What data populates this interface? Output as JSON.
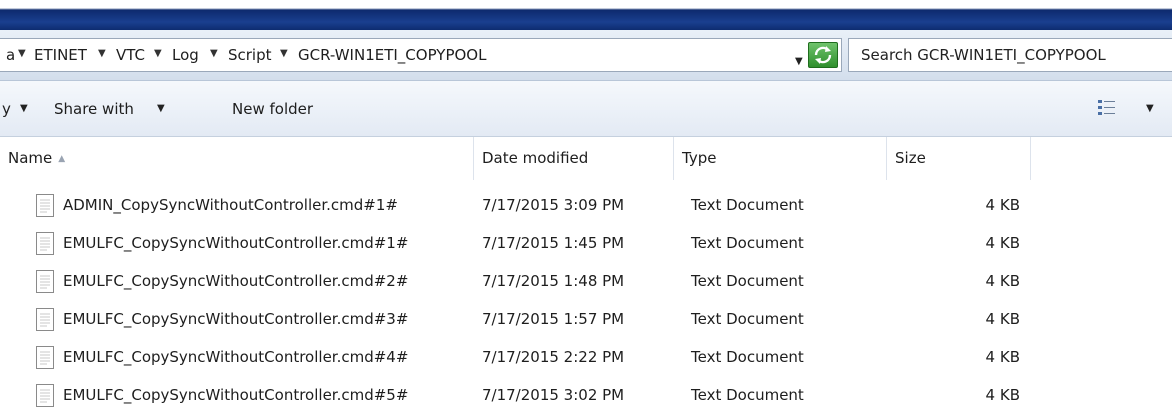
{
  "breadcrumbs": {
    "items": [
      "a",
      "ETINET",
      "VTC",
      "Log",
      "Script",
      "GCR-WIN1ETI_COPYPOOL"
    ]
  },
  "search": {
    "placeholder": "Search GCR-WIN1ETI_COPYPOOL"
  },
  "toolbar": {
    "organize_label": "y",
    "share_label": "Share with",
    "new_folder_label": "New folder"
  },
  "columns": {
    "name": "Name",
    "date": "Date modified",
    "type": "Type",
    "size": "Size"
  },
  "files": [
    {
      "name": "ADMIN_CopySyncWithoutController.cmd#1#",
      "date": "7/17/2015 3:09 PM",
      "type": "Text Document",
      "size": "4 KB"
    },
    {
      "name": "EMULFC_CopySyncWithoutController.cmd#1#",
      "date": "7/17/2015 1:45 PM",
      "type": "Text Document",
      "size": "4 KB"
    },
    {
      "name": "EMULFC_CopySyncWithoutController.cmd#2#",
      "date": "7/17/2015 1:48 PM",
      "type": "Text Document",
      "size": "4 KB"
    },
    {
      "name": "EMULFC_CopySyncWithoutController.cmd#3#",
      "date": "7/17/2015 1:57 PM",
      "type": "Text Document",
      "size": "4 KB"
    },
    {
      "name": "EMULFC_CopySyncWithoutController.cmd#4#",
      "date": "7/17/2015 2:22 PM",
      "type": "Text Document",
      "size": "4 KB"
    },
    {
      "name": "EMULFC_CopySyncWithoutController.cmd#5#",
      "date": "7/17/2015 3:02 PM",
      "type": "Text Document",
      "size": "4 KB"
    }
  ]
}
